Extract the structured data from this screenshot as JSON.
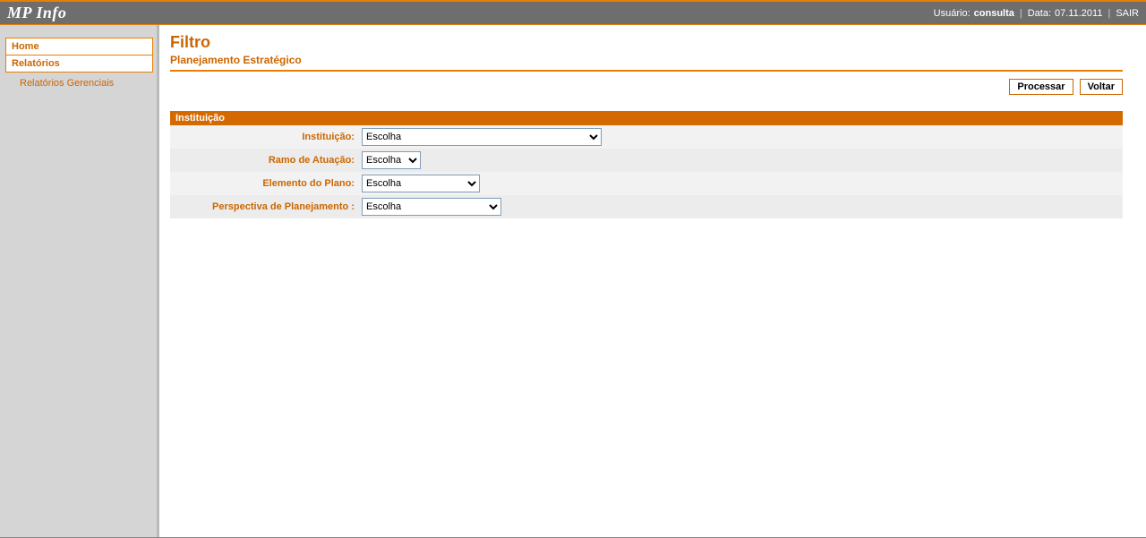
{
  "brand": "MP Info",
  "header": {
    "user_label": "Usuário:",
    "user_value": "consulta",
    "date_label": "Data:",
    "date_value": "07.11.2011",
    "logout": "SAIR"
  },
  "sidebar": {
    "items": [
      {
        "label": "Home"
      },
      {
        "label": "Relatórios"
      }
    ],
    "subitem": "Relatórios Gerenciais"
  },
  "page": {
    "title": "Filtro",
    "subtitle": "Planejamento Estratégico"
  },
  "actions": {
    "processar": "Processar",
    "voltar": "Voltar"
  },
  "section_title": "Instituição",
  "form": {
    "rows": [
      {
        "label": "Instituição:",
        "value": "Escolha",
        "cls": "sel-instituicao"
      },
      {
        "label": "Ramo de Atuação:",
        "value": "Escolha",
        "cls": "sel-ramo"
      },
      {
        "label": "Elemento do Plano:",
        "value": "Escolha",
        "cls": "sel-elemento"
      },
      {
        "label": "Perspectiva de Planejamento :",
        "value": "Escolha",
        "cls": "sel-perspectiva"
      }
    ]
  }
}
